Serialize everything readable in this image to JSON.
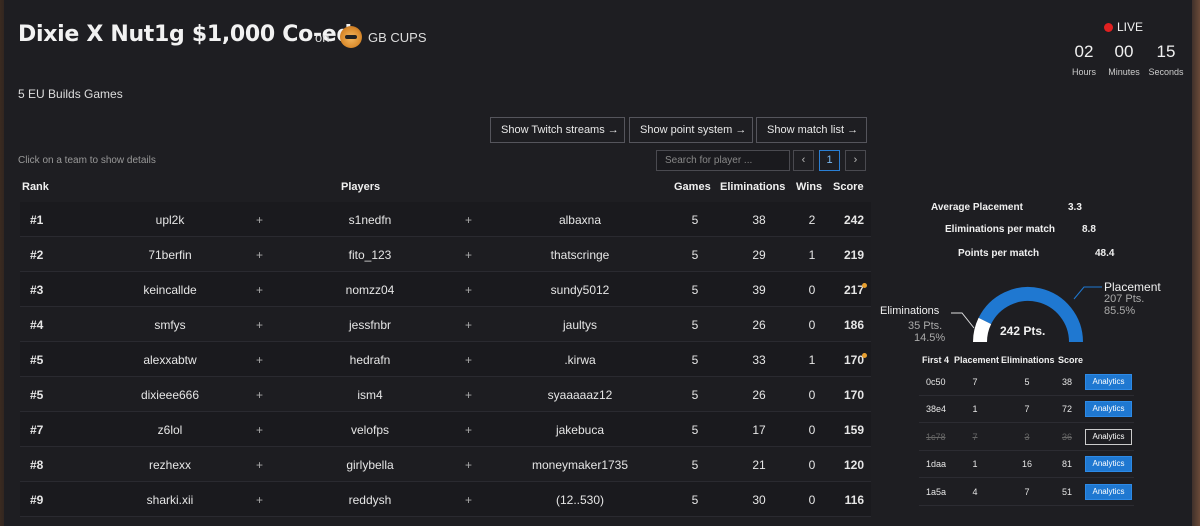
{
  "header": {
    "title": "Dixie X Nut1g $1,000 Co-ed",
    "on_label": "on",
    "organizer": "GB CUPS",
    "subtitle": "5 EU Builds Games"
  },
  "live": {
    "label": "LIVE",
    "hours": "02",
    "hours_label": "Hours",
    "minutes": "00",
    "minutes_label": "Minutes",
    "seconds": "15",
    "seconds_label": "Seconds"
  },
  "toolbar": {
    "twitch": "Show Twitch streams",
    "points": "Show point system",
    "matches": "Show match list",
    "hint": "Click on a team to show details",
    "search_placeholder": "Search for player ...",
    "prev": "‹",
    "page": "1",
    "next": "›"
  },
  "table": {
    "headers": {
      "rank": "Rank",
      "players": "Players",
      "games": "Games",
      "elims": "Eliminations",
      "wins": "Wins",
      "score": "Score"
    },
    "plus": "+",
    "rows": [
      {
        "rank": "#1",
        "p1": "upl2k",
        "p2": "s1nedfn",
        "p3": "albaxna",
        "games": "5",
        "elims": "38",
        "wins": "2",
        "score": "242",
        "dot": false
      },
      {
        "rank": "#2",
        "p1": "71berfin",
        "p2": "fito_123",
        "p3": "thatscringe",
        "games": "5",
        "elims": "29",
        "wins": "1",
        "score": "219",
        "dot": false
      },
      {
        "rank": "#3",
        "p1": "keincallde",
        "p2": "nomzz04",
        "p3": "sundy5012",
        "games": "5",
        "elims": "39",
        "wins": "0",
        "score": "217",
        "dot": true
      },
      {
        "rank": "#4",
        "p1": "smfys",
        "p2": "jessfnbr",
        "p3": "jaultys",
        "games": "5",
        "elims": "26",
        "wins": "0",
        "score": "186",
        "dot": false
      },
      {
        "rank": "#5",
        "p1": "alexxabtw",
        "p2": "hedrafn",
        "p3": ".kirwa",
        "games": "5",
        "elims": "33",
        "wins": "1",
        "score": "170",
        "dot": true
      },
      {
        "rank": "#5",
        "p1": "dixieee666",
        "p2": "ism4",
        "p3": "syaaaaaz12",
        "games": "5",
        "elims": "26",
        "wins": "0",
        "score": "170",
        "dot": false
      },
      {
        "rank": "#7",
        "p1": "z6lol",
        "p2": "velofps",
        "p3": "jakebuca",
        "games": "5",
        "elims": "17",
        "wins": "0",
        "score": "159",
        "dot": false
      },
      {
        "rank": "#8",
        "p1": "rezhexx",
        "p2": "girlybella",
        "p3": "moneymaker1735",
        "games": "5",
        "elims": "21",
        "wins": "0",
        "score": "120",
        "dot": false
      },
      {
        "rank": "#9",
        "p1": "sharki.xii",
        "p2": "reddysh",
        "p3": "(12..530)",
        "games": "5",
        "elims": "30",
        "wins": "0",
        "score": "116",
        "dot": false
      }
    ]
  },
  "details": {
    "avg_placement_label": "Average Placement",
    "avg_placement": "3.3",
    "epm_label": "Eliminations per match",
    "epm": "8.8",
    "ppm_label": "Points per match",
    "ppm": "48.4",
    "gauge": {
      "total": "242 Pts.",
      "elims_label": "Eliminations",
      "elims_pts": "35 Pts.",
      "elims_pct": "14.5%",
      "place_label": "Placement",
      "place_pts": "207 Pts.",
      "place_pct": "85.5%",
      "place_fraction": 0.855,
      "color_place": "#1f78d1",
      "color_elims": "#ffffff"
    },
    "matches_headers": {
      "first4": "First 4",
      "placement": "Placement",
      "elims": "Eliminations",
      "score": "Score"
    },
    "matches": [
      {
        "id": "0c50",
        "placement": "7",
        "elims": "5",
        "score": "38",
        "button": "Analytics",
        "disabled": false
      },
      {
        "id": "38e4",
        "placement": "1",
        "elims": "7",
        "score": "72",
        "button": "Analytics",
        "disabled": false
      },
      {
        "id": "1c78",
        "placement": "7",
        "elims": "3",
        "score": "36",
        "button": "Analytics",
        "disabled": true
      },
      {
        "id": "1daa",
        "placement": "1",
        "elims": "16",
        "score": "81",
        "button": "Analytics",
        "disabled": false
      },
      {
        "id": "1a5a",
        "placement": "4",
        "elims": "7",
        "score": "51",
        "button": "Analytics",
        "disabled": false
      }
    ]
  }
}
